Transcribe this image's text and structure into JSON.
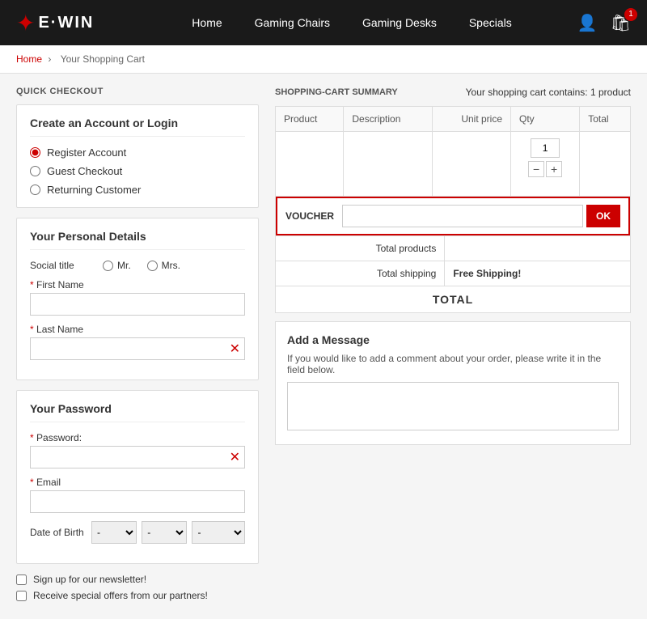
{
  "header": {
    "logo_star": "✦",
    "logo_dash": "E·WIN",
    "nav": {
      "home": "Home",
      "chairs": "Gaming Chairs",
      "desks": "Gaming Desks",
      "specials": "Specials"
    },
    "cart_count": "1"
  },
  "breadcrumb": {
    "home": "Home",
    "separator": "›",
    "current": "Your Shopping Cart"
  },
  "left": {
    "section_title": "QUICK CHECKOUT",
    "account_card": {
      "title": "Create an Account or Login",
      "options": [
        {
          "id": "register",
          "label": "Register Account",
          "checked": true
        },
        {
          "id": "guest",
          "label": "Guest Checkout",
          "checked": false
        },
        {
          "id": "returning",
          "label": "Returning Customer",
          "checked": false
        }
      ]
    },
    "details_card": {
      "title": "Your Personal Details",
      "social_title_label": "Social title",
      "mr_label": "Mr.",
      "mrs_label": "Mrs.",
      "first_name_label": "First Name",
      "last_name_label": "Last Name",
      "first_name_placeholder": "",
      "last_name_placeholder": ""
    },
    "password_card": {
      "title": "Your Password",
      "password_label": "Password:",
      "email_label": "Email",
      "dob_label": "Date of Birth",
      "dob_day": "-",
      "dob_month": "-",
      "dob_year": "-"
    },
    "newsletter_label": "Sign up for our newsletter!",
    "partners_label": "Receive special offers from our partners!"
  },
  "right": {
    "section_title": "SHOPPING-CART SUMMARY",
    "cart_info": "Your shopping cart contains: 1 product",
    "table": {
      "headers": [
        "Product",
        "Description",
        "Unit price",
        "Qty",
        "Total"
      ],
      "qty_value": "1"
    },
    "voucher": {
      "label": "VOUCHER",
      "placeholder": "",
      "btn_label": "OK"
    },
    "totals": {
      "total_products_label": "Total products",
      "total_products_value": "",
      "total_shipping_label": "Total shipping",
      "total_shipping_value": "Free Shipping!",
      "total_label": "TOTAL"
    },
    "message": {
      "title": "Add a Message",
      "description": "If you would like to add a comment about your order, please write it in the field below.",
      "placeholder": ""
    }
  }
}
